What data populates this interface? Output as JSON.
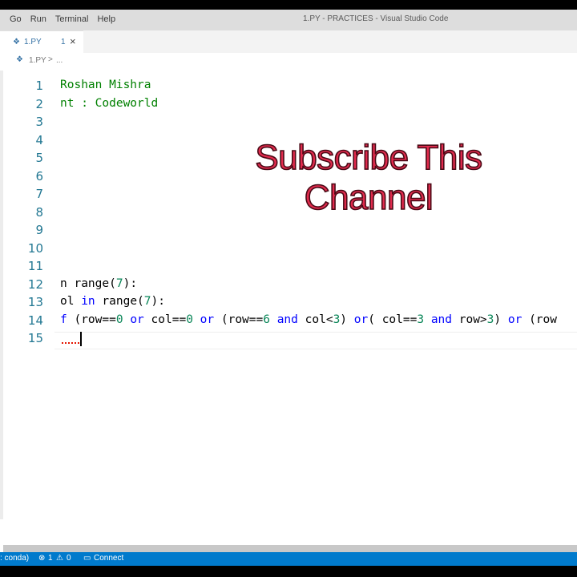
{
  "menu": [
    "Go",
    "Run",
    "Terminal",
    "Help"
  ],
  "window_title": "1.PY - PRACTICES - Visual Studio Code",
  "tab": {
    "label": "1.PY",
    "problems": "1",
    "close": "×"
  },
  "breadcrumb": {
    "file": "1.PY",
    "sep": ">",
    "more": "..."
  },
  "overlay": {
    "line1": "Subscribe This",
    "line2": "Channel"
  },
  "editor": {
    "line_numbers": [
      "1",
      "2",
      "3",
      "4",
      "5",
      "6",
      "7",
      "8",
      "9",
      "10",
      "11",
      "12",
      "13",
      "14",
      "15"
    ],
    "lines": {
      "l1": "Roshan Mishra",
      "l2": "nt : Codeworld",
      "l12_a": "n ",
      "l12_kw": "range",
      "l12_b": "(",
      "l12_num": "7",
      "l12_c": "):",
      "l13_a": "ol ",
      "l13_kw1": "in",
      "l13_b": " range(",
      "l13_num": "7",
      "l13_c": "):",
      "l14": [
        {
          "t": "f ",
          "c": "kw"
        },
        {
          "t": "(row==",
          "c": ""
        },
        {
          "t": "0",
          "c": "num"
        },
        {
          "t": " ",
          "c": ""
        },
        {
          "t": "or",
          "c": "kw"
        },
        {
          "t": " col==",
          "c": ""
        },
        {
          "t": "0",
          "c": "num"
        },
        {
          "t": " ",
          "c": ""
        },
        {
          "t": "or",
          "c": "kw"
        },
        {
          "t": " (row==",
          "c": ""
        },
        {
          "t": "6",
          "c": "num"
        },
        {
          "t": " ",
          "c": ""
        },
        {
          "t": "and",
          "c": "kw"
        },
        {
          "t": " col<",
          "c": ""
        },
        {
          "t": "3",
          "c": "num"
        },
        {
          "t": ") ",
          "c": ""
        },
        {
          "t": "or",
          "c": "kw"
        },
        {
          "t": "( col==",
          "c": ""
        },
        {
          "t": "3",
          "c": "num"
        },
        {
          "t": " ",
          "c": ""
        },
        {
          "t": "and",
          "c": "kw"
        },
        {
          "t": " row>",
          "c": ""
        },
        {
          "t": "3",
          "c": "num"
        },
        {
          "t": ") ",
          "c": ""
        },
        {
          "t": "or",
          "c": "kw"
        },
        {
          "t": " (row",
          "c": ""
        }
      ]
    }
  },
  "status": {
    "env": ": conda)",
    "errors_icon": "⊗",
    "errors": "1",
    "warnings_icon": "⚠",
    "warnings": "0",
    "connect_icon": "▭",
    "connect": "Connect"
  }
}
